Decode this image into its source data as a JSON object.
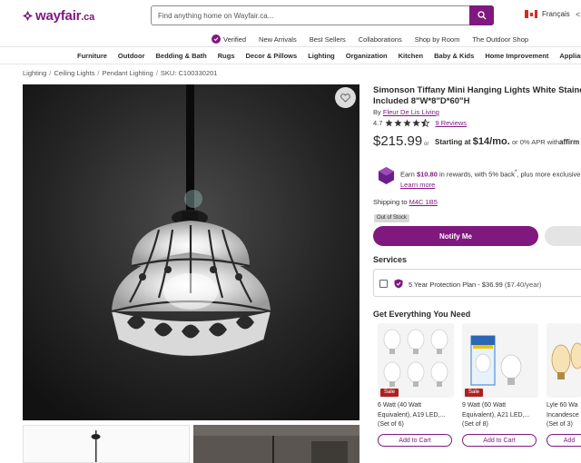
{
  "header": {
    "logo_text": "wayfair",
    "logo_suffix": ".ca",
    "search_placeholder": "Find anything home on Wayfair.ca...",
    "language": "Français",
    "brand_color": "#7f187f"
  },
  "top_links": [
    "Verified",
    "New Arrivals",
    "Best Sellers",
    "Collaborations",
    "Shop by Room",
    "The Outdoor Shop"
  ],
  "categories": [
    "Furniture",
    "Outdoor",
    "Bedding & Bath",
    "Rugs",
    "Decor & Pillows",
    "Lighting",
    "Organization",
    "Kitchen",
    "Baby & Kids",
    "Home Improvement",
    "Appliances"
  ],
  "breadcrumb": [
    "Lighting",
    "Ceiling Lights",
    "Pendant Lighting",
    "SKU: C100330201"
  ],
  "product": {
    "title_line1": "Simonson Tiffany Mini Hanging Lights White Stained",
    "title_line2": "Included 8\"W*8\"D*60\"H",
    "by_label": "By",
    "brand": "Fleur De Lis Living",
    "rating_value": "4.7",
    "rating_stars": 4.5,
    "reviews": "9 Reviews",
    "price": "$215.99",
    "or_label": "or",
    "starting_label": "Starting at",
    "monthly": "$14/mo.",
    "apr_text": "or 0% APR with",
    "affirm": "affirm",
    "rewards_prefix": "Earn",
    "rewards_amount": "$10.80",
    "rewards_suffix": "in rewards, with 5% back",
    "rewards_tail": ", plus more exclusive",
    "learn_more": "Learn more",
    "shipping_label": "Shipping to",
    "postal_code": "M4C 1B5",
    "stock_status": "Out of Stock",
    "notify_label": "Notify Me"
  },
  "services": {
    "heading": "Services",
    "plan_label": "5 Year Protection Plan - $36.99",
    "plan_monthly": "($7.40/year)"
  },
  "recommendations": {
    "heading": "Get Everything You Need",
    "items": [
      {
        "badge": "Sale",
        "name_line1": "6 Watt (40 Watt",
        "name_line2": "Equivalent), A19 LED,...",
        "name_line3": "(Set of 6)",
        "button": "Add to Cart"
      },
      {
        "badge": "Sale",
        "name_line1": "9 Watt (60 Watt",
        "name_line2": "Equivalent), A21 LED,...",
        "name_line3": "(Set of 8)",
        "button": "Add to Cart"
      },
      {
        "badge": "",
        "name_line1": "Lyle 60 Wa",
        "name_line2": "Incandesce",
        "name_line3": "(Set of 3)",
        "button": "Add"
      }
    ]
  }
}
